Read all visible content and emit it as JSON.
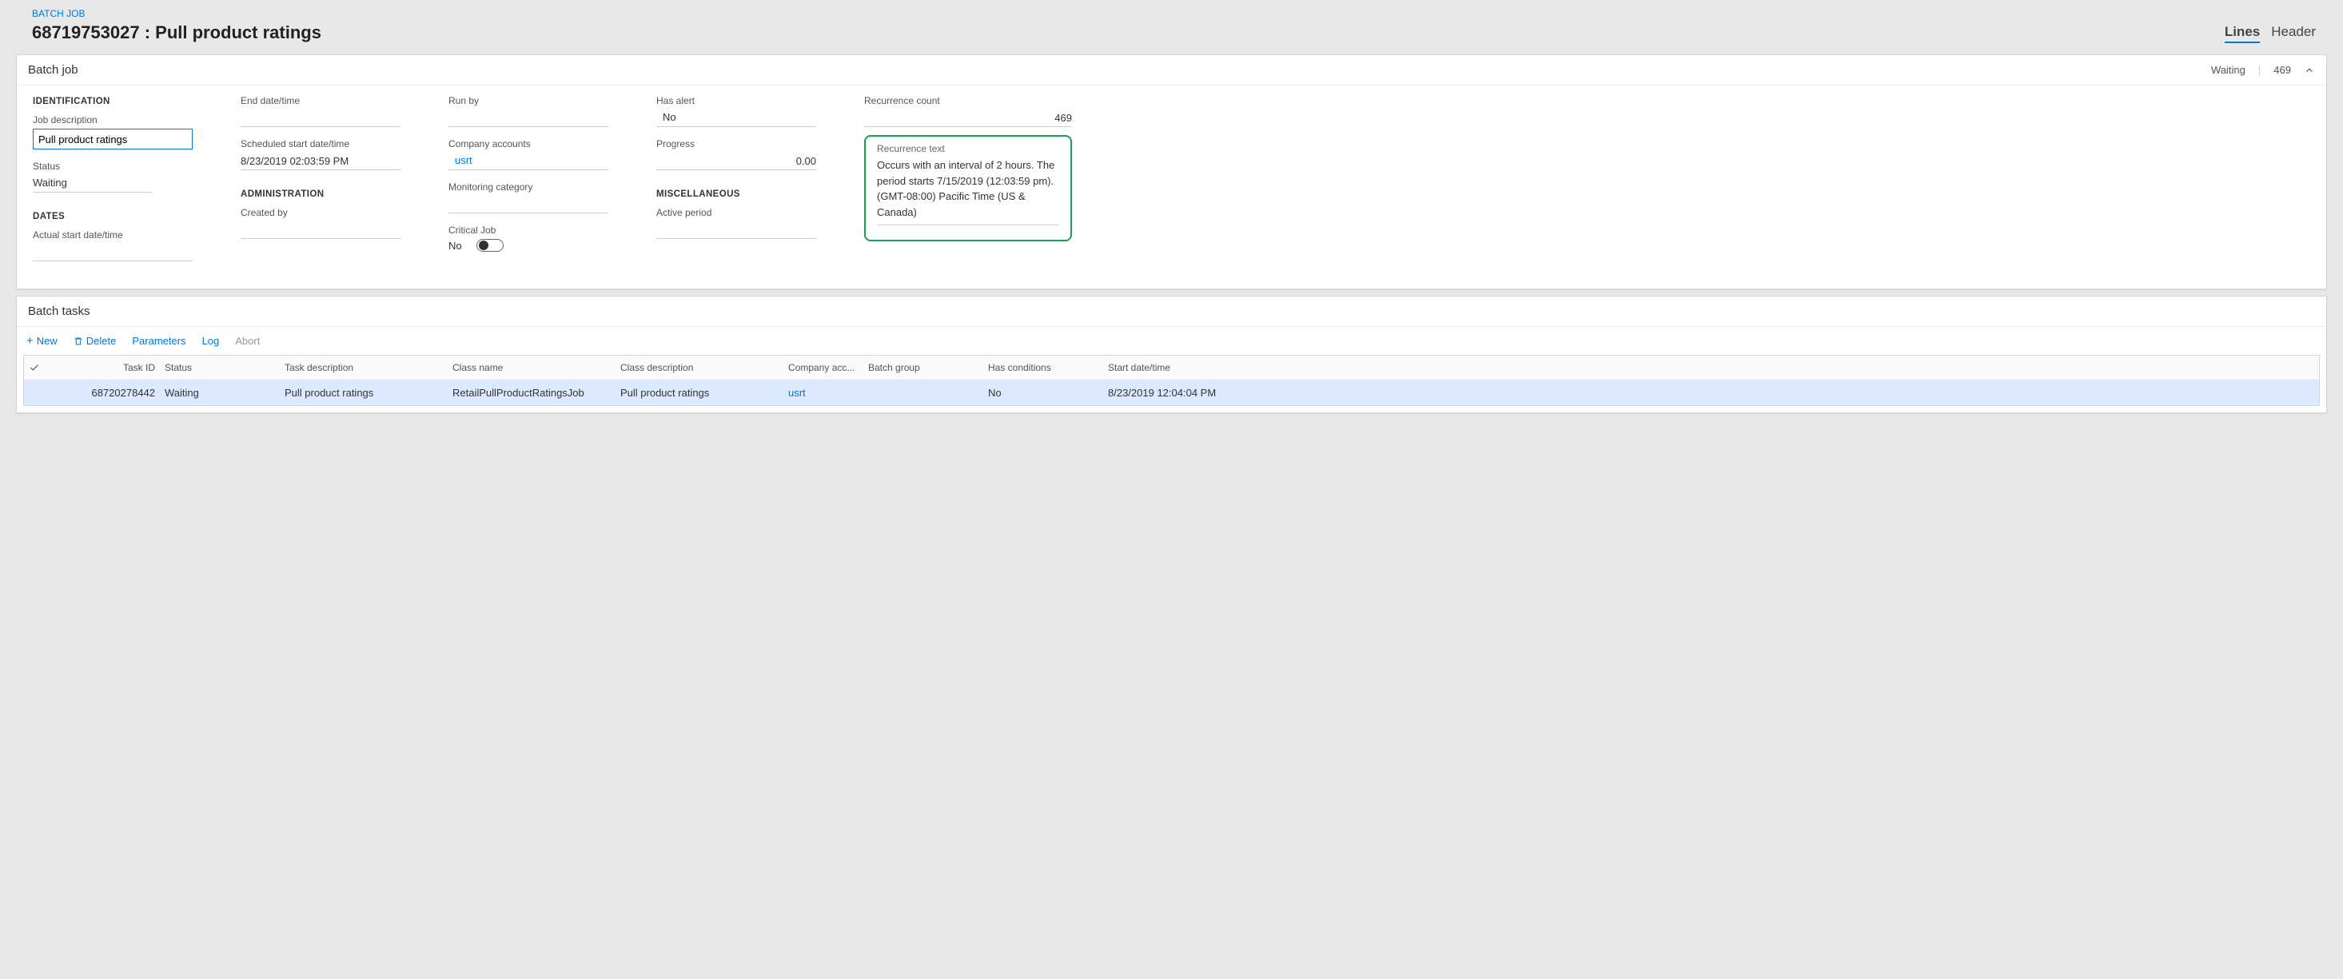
{
  "breadcrumb": "BATCH JOB",
  "page_title": "68719753027 : Pull product ratings",
  "tabs": {
    "lines": "Lines",
    "header": "Header"
  },
  "batch_job": {
    "section_title": "Batch job",
    "status_summary": "Waiting",
    "count": "469",
    "identification": {
      "section": "IDENTIFICATION",
      "desc_label": "Job description",
      "desc_value": "Pull product ratings",
      "status_label": "Status",
      "status_value": "Waiting"
    },
    "dates": {
      "section": "DATES",
      "actual_label": "Actual start date/time",
      "actual_value": "",
      "end_label": "End date/time",
      "end_value": "",
      "sched_label": "Scheduled start date/time",
      "sched_value": "8/23/2019 02:03:59 PM"
    },
    "admin": {
      "section": "ADMINISTRATION",
      "createdby_label": "Created by",
      "createdby_value": "",
      "runby_label": "Run by",
      "runby_value": "",
      "company_label": "Company accounts",
      "company_value": "usrt",
      "monitor_label": "Monitoring category",
      "monitor_value": "",
      "critical_label": "Critical Job",
      "critical_value": "No"
    },
    "fields": {
      "alert_label": "Has alert",
      "alert_value": "No",
      "progress_label": "Progress",
      "progress_value": "0.00",
      "reccount_label": "Recurrence count",
      "reccount_value": "469",
      "rectext_label": "Recurrence text",
      "rectext_value": "Occurs with an interval of 2 hours. The period starts 7/15/2019 (12:03:59 pm). (GMT-08:00) Pacific Time (US & Canada)"
    },
    "misc": {
      "section": "MISCELLANEOUS",
      "active_label": "Active period",
      "active_value": ""
    }
  },
  "batch_tasks": {
    "section_title": "Batch tasks",
    "toolbar": {
      "new": "New",
      "delete": "Delete",
      "params": "Parameters",
      "log": "Log",
      "abort": "Abort"
    },
    "columns": {
      "taskid": "Task ID",
      "status": "Status",
      "taskdesc": "Task description",
      "classname": "Class name",
      "classdesc": "Class description",
      "company": "Company acc...",
      "batchgroup": "Batch group",
      "hascond": "Has conditions",
      "startdt": "Start date/time"
    },
    "row": {
      "taskid": "68720278442",
      "status": "Waiting",
      "taskdesc": "Pull product ratings",
      "classname": "RetailPullProductRatingsJob",
      "classdesc": "Pull product ratings",
      "company": "usrt",
      "batchgroup": "",
      "hascond": "No",
      "startdt": "8/23/2019 12:04:04 PM"
    }
  }
}
